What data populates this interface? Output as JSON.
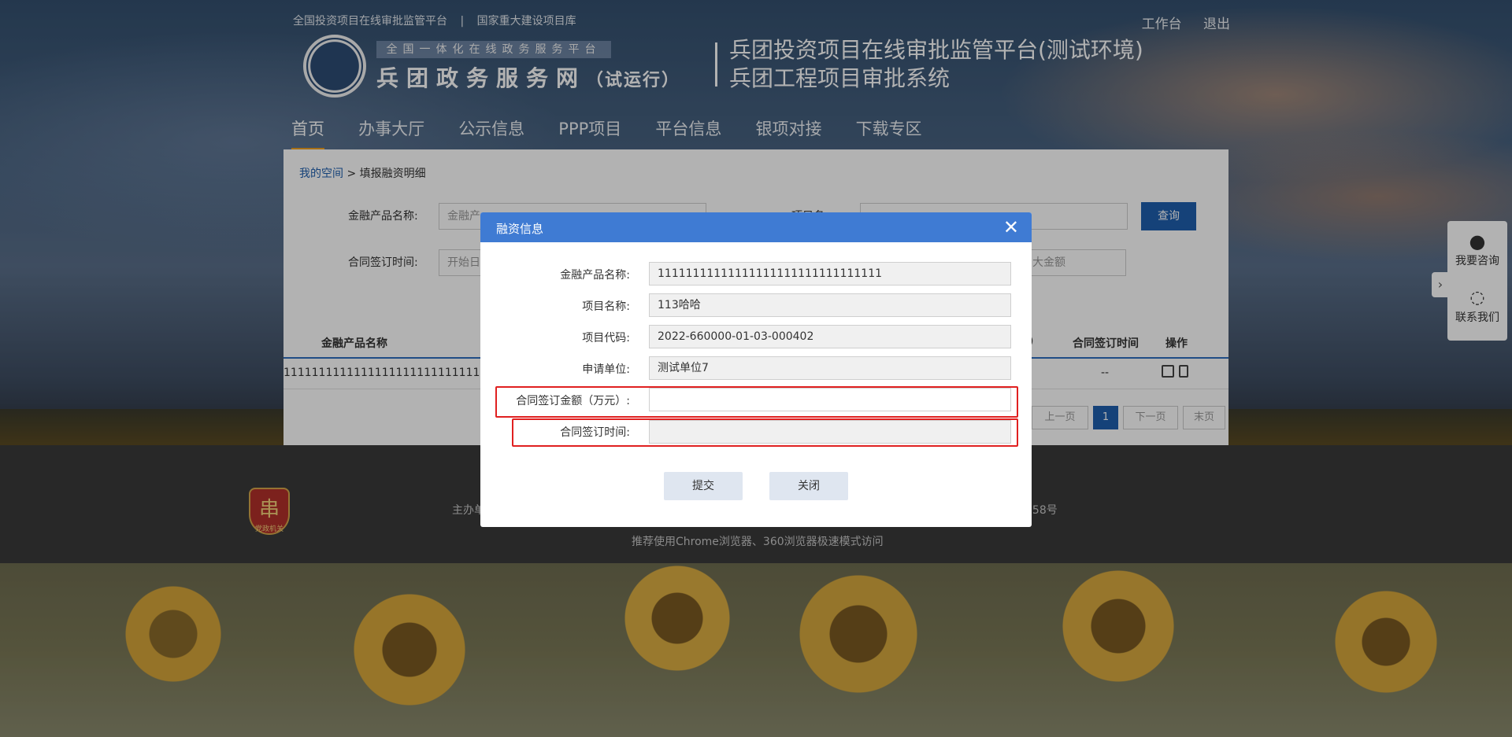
{
  "header": {
    "top_links": [
      "全国投资项目在线审批监管平台",
      "国家重大建设项目库"
    ],
    "top_separator": "|",
    "top_right": [
      "工作台",
      "退出"
    ],
    "logo_strip": "全国一体化在线政务服务平台",
    "logo_title": "兵团政务服务网",
    "logo_title_suffix": "（试运行）",
    "system_title_line1": "兵团投资项目在线审批监管平台(测试环境)",
    "system_title_line2": "兵团工程项目审批系统"
  },
  "nav": {
    "items": [
      "首页",
      "办事大厅",
      "公示信息",
      "PPP项目",
      "平台信息",
      "银项对接",
      "下载专区"
    ],
    "active_index": 0
  },
  "breadcrumb": {
    "link": "我的空间",
    "separator": ">",
    "current": "填报融资明细"
  },
  "filters": {
    "product_label": "金融产品名称:",
    "product_placeholder": "金融产",
    "project_label": "项目名",
    "contract_time_label": "合同签订时间:",
    "contract_time_placeholder": "开始日",
    "max_amount_placeholder": "大金额",
    "query_button": "查询"
  },
  "table": {
    "headers": [
      "金融产品名称",
      ")",
      "合同签订时间",
      "操作"
    ],
    "row": {
      "product": "11111111111111111111111111111",
      "contract_time": "--"
    }
  },
  "pager": {
    "prev": "上一页",
    "current": "1",
    "next": "下一页",
    "last": "末页"
  },
  "side_float": {
    "consult": "我要咨询",
    "contact": "联系我们",
    "toggle": "›"
  },
  "footer": {
    "sponsor_fragment": "主办单",
    "icp_fragment": "058号",
    "browser_tip": "推荐使用Chrome浏览器、360浏览器极速模式访问",
    "emblem_char": "串",
    "emblem_caption": "党政机关"
  },
  "dialog": {
    "title": "融资信息",
    "close": "✕",
    "fields": [
      {
        "label": "金融产品名称:",
        "value": "11111111111111111111111111111111"
      },
      {
        "label": "项目名称:",
        "value": "113哈哈"
      },
      {
        "label": "项目代码:",
        "value": "2022-660000-01-03-000402"
      },
      {
        "label": "申请单位:",
        "value": "测试单位7"
      },
      {
        "label": "合同签订金额（万元）:",
        "value": ""
      },
      {
        "label": "合同签订时间:",
        "value": ""
      }
    ],
    "submit": "提交",
    "close_button": "关闭"
  },
  "colors": {
    "primary": "#3f7bd3",
    "nav_active": "#f0a020",
    "highlight": "#e02020"
  }
}
